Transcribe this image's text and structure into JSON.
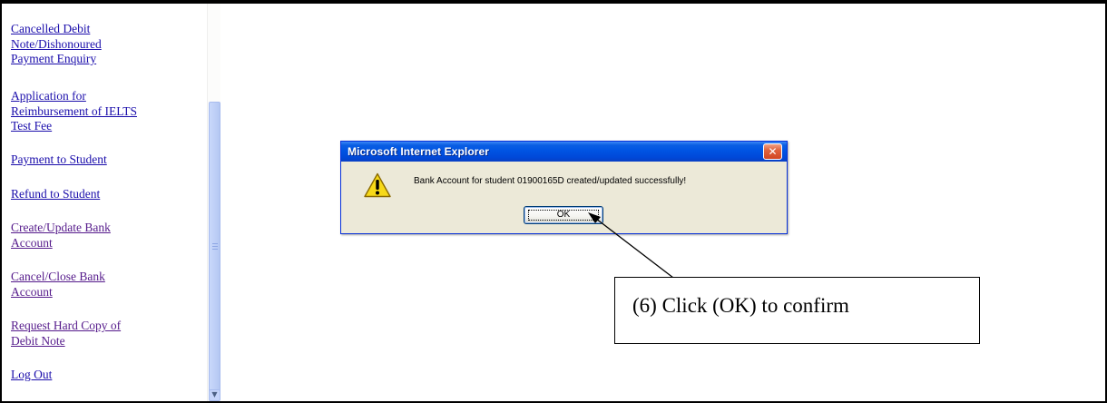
{
  "sidebar": {
    "items": [
      {
        "label": "Cancelled Debit\nNote/Dishonoured\nPayment Enquiry",
        "visited": false
      },
      {
        "label": "Application for\nReimbursement of IELTS\nTest Fee",
        "visited": false
      },
      {
        "label": "Payment to Student",
        "visited": false
      },
      {
        "label": "Refund to Student",
        "visited": false
      },
      {
        "label": "Create/Update Bank\nAccount",
        "visited": true
      },
      {
        "label": "Cancel/Close Bank\nAccount",
        "visited": true
      },
      {
        "label": "Request Hard Copy of\nDebit Note",
        "visited": true
      },
      {
        "label": "Log Out",
        "visited": false
      }
    ]
  },
  "dialog": {
    "title": "Microsoft Internet Explorer",
    "message": "Bank Account for student 01900165D created/updated successfully!",
    "ok_label": "OK",
    "icon": "warning-icon"
  },
  "annotation": {
    "text": "(6) Click (OK) to confirm"
  },
  "colors": {
    "link": "#1a0dab",
    "visited_link": "#551a8b",
    "titlebar": "#0054e3",
    "dialog_bg": "#ece9d8"
  }
}
